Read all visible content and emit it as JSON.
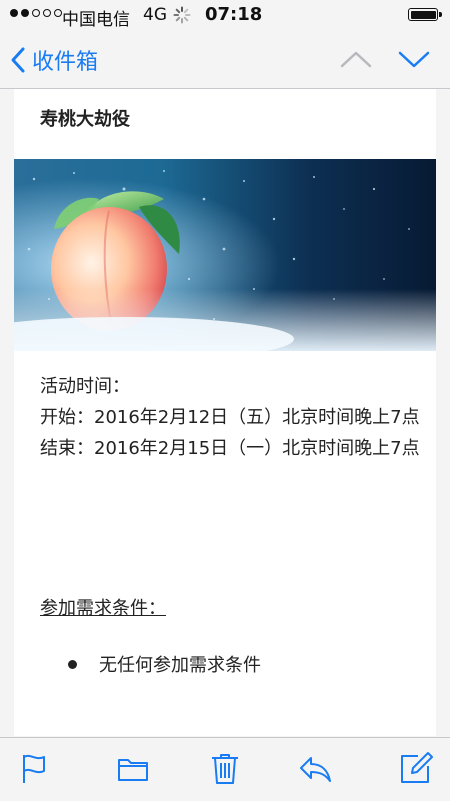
{
  "status_bar": {
    "signal": "●●○○○",
    "carrier": "中国电信",
    "network": "4G",
    "time": "07:18"
  },
  "nav": {
    "back_label": "收件箱",
    "back_icon": "chevron-left-icon",
    "prev_icon": "chevron-up-icon",
    "next_icon": "chevron-down-icon",
    "accent_color": "#1a7cf2"
  },
  "email": {
    "subject": "寿桃大劫役",
    "banner_alt": "peach-banner",
    "schedule_heading": "活动时间：",
    "start_line": "开始：2016年2月12日（五）北京时间晚上7点",
    "end_line": "结束：2016年2月15日（一）北京时间晚上7点",
    "requirements_title": "参加需求条件：",
    "requirements": [
      "无任何参加需求条件"
    ]
  },
  "toolbar": {
    "icons": [
      "flag-icon",
      "folder-icon",
      "trash-icon",
      "reply-icon",
      "compose-icon"
    ]
  }
}
